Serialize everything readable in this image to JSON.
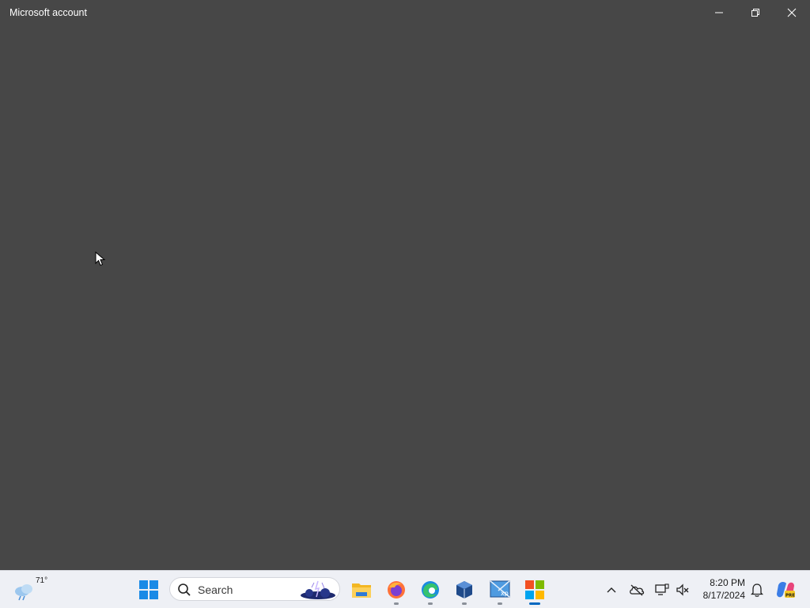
{
  "window": {
    "title": "Microsoft account",
    "controls": [
      "minimize-icon",
      "restore-icon",
      "close-icon"
    ]
  },
  "taskbar": {
    "weather": {
      "temperature": "71°",
      "icon": "weather-cloud-icon"
    },
    "search": {
      "placeholder": "Search"
    },
    "pinned_apps": [
      {
        "name": "File Explorer",
        "icon": "folder-icon",
        "running": false
      },
      {
        "name": "Firefox",
        "icon": "firefox-icon",
        "running": true
      },
      {
        "name": "Microsoft Edge",
        "icon": "edge-icon",
        "running": true
      },
      {
        "name": "VirtualBox",
        "icon": "virtualbox-icon",
        "running": true
      },
      {
        "name": "Windows XP VM",
        "icon": "xp-icon",
        "running": true
      },
      {
        "name": "Microsoft Store",
        "icon": "store-icon",
        "running": true,
        "active": true
      }
    ],
    "tray": {
      "icons": [
        "chevron-up-icon",
        "onedrive-icon",
        "network-icon",
        "volume-muted-icon"
      ],
      "time": "8:20 PM",
      "date": "8/17/2024"
    }
  },
  "colors": {
    "window_bg": "#474747",
    "taskbar_bg": "#eef0f5",
    "accent": "#0067c0"
  }
}
